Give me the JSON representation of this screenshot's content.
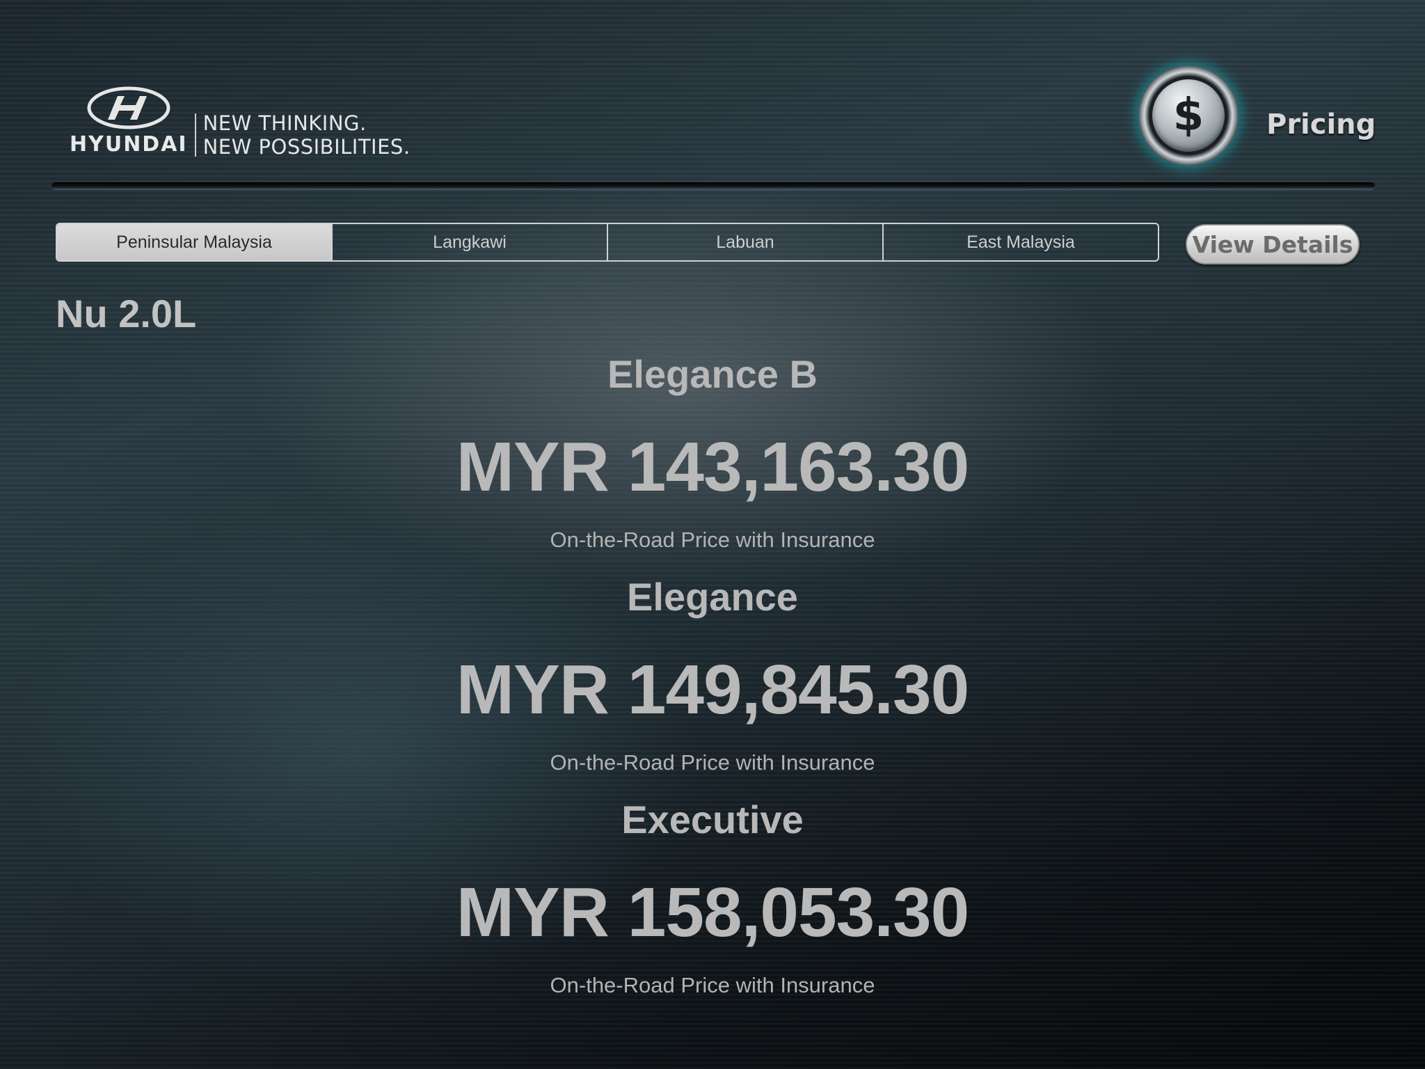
{
  "brand": {
    "wordmark": "HYUNDAI",
    "tagline_line1": "NEW THINKING.",
    "tagline_line2": "NEW POSSIBILITIES."
  },
  "section": {
    "icon": "dollar-icon",
    "icon_glyph": "$",
    "title": "Pricing",
    "accent_color": "#14bec8"
  },
  "regions": {
    "tabs": [
      {
        "label": "Peninsular Malaysia",
        "active": true
      },
      {
        "label": "Langkawi",
        "active": false
      },
      {
        "label": "Labuan",
        "active": false
      },
      {
        "label": "East Malaysia",
        "active": false
      }
    ]
  },
  "actions": {
    "view_details_label": "View Details"
  },
  "model": {
    "name": "Nu 2.0L"
  },
  "variants": [
    {
      "name": "Elegance B",
      "price": "MYR 143,163.30",
      "note": "On-the-Road Price with Insurance"
    },
    {
      "name": "Elegance",
      "price": "MYR 149,845.30",
      "note": "On-the-Road Price with Insurance"
    },
    {
      "name": "Executive",
      "price": "MYR 158,053.30",
      "note": "On-the-Road Price with Insurance"
    }
  ]
}
